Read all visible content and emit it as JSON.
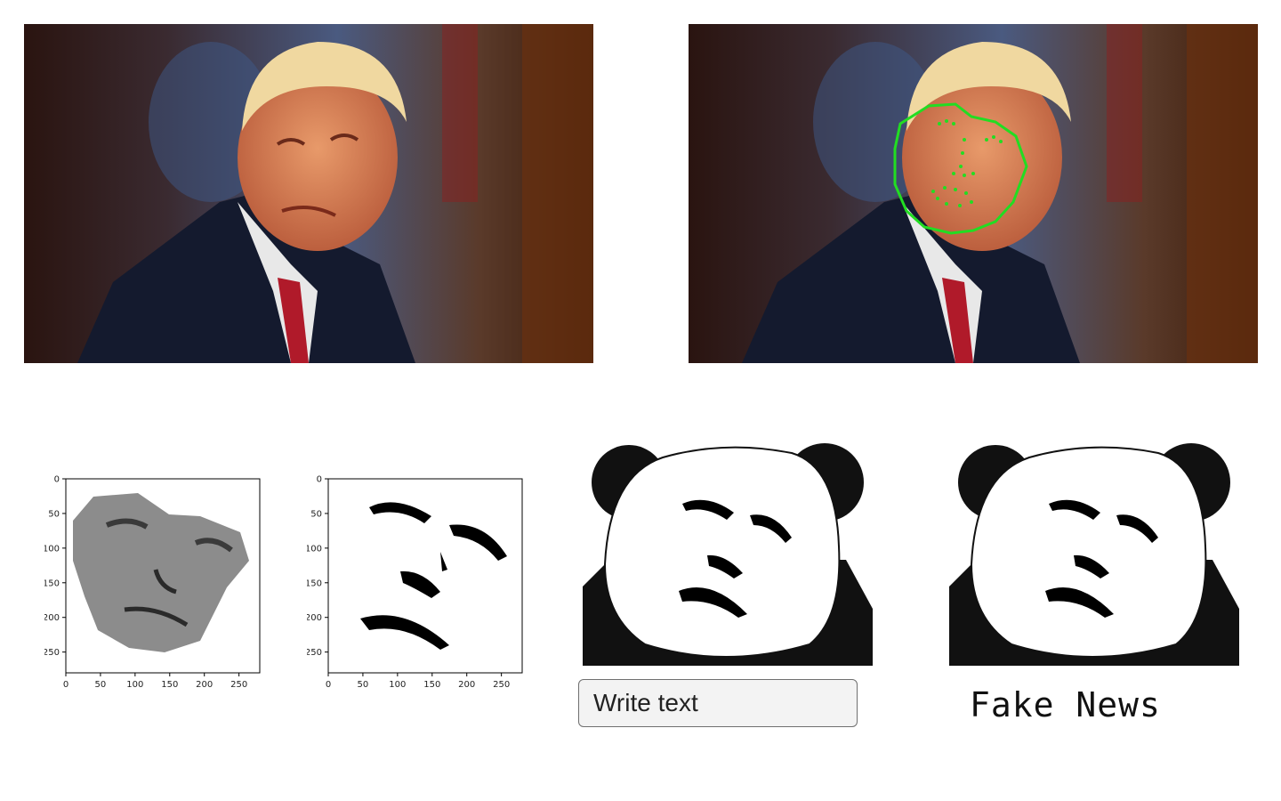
{
  "panels": {
    "original_photo": {
      "description_icon": "portrait-photo"
    },
    "landmark_photo": {
      "landmark_color": "#22dd22"
    }
  },
  "plots": [
    {
      "x_ticks": [
        "0",
        "50",
        "100",
        "150",
        "200",
        "250"
      ],
      "y_ticks": [
        "0",
        "50",
        "100",
        "150",
        "200",
        "250"
      ]
    },
    {
      "x_ticks": [
        "0",
        "50",
        "100",
        "150",
        "200",
        "250"
      ],
      "y_ticks": [
        "0",
        "50",
        "100",
        "150",
        "200",
        "250"
      ]
    }
  ],
  "editor": {
    "input_value": "Write text",
    "caption": "Fake News"
  }
}
